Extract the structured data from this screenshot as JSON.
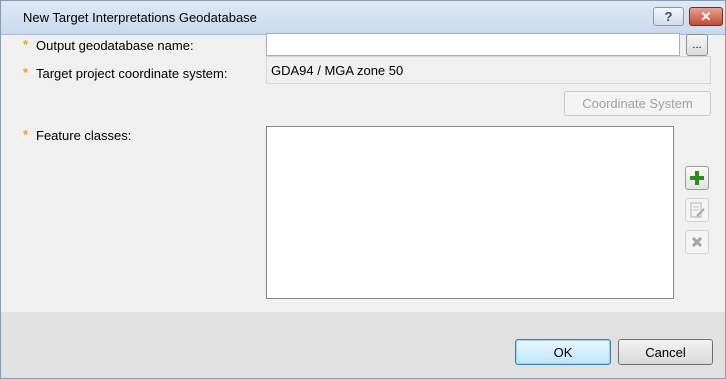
{
  "window": {
    "title": "New Target Interpretations Geodatabase",
    "help_label": "?",
    "close_label": "✕"
  },
  "form": {
    "required_marker": "*",
    "output_name_label": "Output geodatabase name:",
    "output_name_value": "",
    "browse_label": "...",
    "coord_label": "Target project coordinate system:",
    "coord_value": "GDA94 / MGA zone 50",
    "coord_button_label": "Coordinate System",
    "feature_classes_label": "Feature classes:",
    "feature_classes": []
  },
  "side_buttons": {
    "add_icon": "plus-icon",
    "edit_icon": "edit-document-icon",
    "remove_icon": "delete-x-icon"
  },
  "footer": {
    "ok_label": "OK",
    "cancel_label": "Cancel"
  },
  "colors": {
    "required": "#f0a21a",
    "add_icon": "#2e8b1e",
    "title_bar": "#dfe9f5",
    "footer_bg": "#e1e1e1"
  }
}
